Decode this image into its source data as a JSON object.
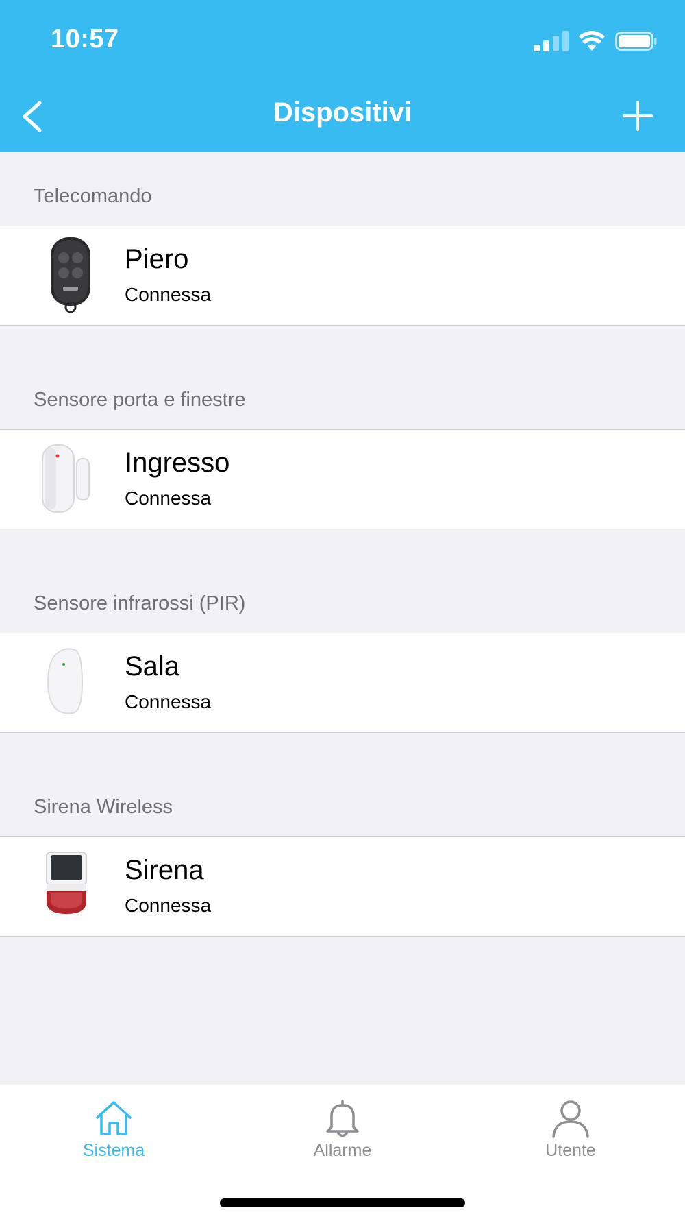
{
  "status_bar": {
    "time": "10:57"
  },
  "nav": {
    "title": "Dispositivi"
  },
  "colors": {
    "accent": "#37bbf0",
    "tab_inactive": "#8e8e93",
    "background": "#f1f1f6"
  },
  "sections": [
    {
      "header": "Telecomando",
      "device": {
        "name": "Piero",
        "status": "Connessa",
        "icon": "remote-keyfob-icon"
      }
    },
    {
      "header": "Sensore porta e finestre",
      "device": {
        "name": "Ingresso",
        "status": "Connessa",
        "icon": "door-sensor-icon"
      }
    },
    {
      "header": "Sensore infrarossi (PIR)",
      "device": {
        "name": "Sala",
        "status": "Connessa",
        "icon": "pir-sensor-icon"
      }
    },
    {
      "header": "Sirena Wireless",
      "device": {
        "name": "Sirena",
        "status": "Connessa",
        "icon": "siren-icon"
      }
    }
  ],
  "tabbar": {
    "tabs": [
      {
        "label": "Sistema",
        "icon": "home-icon",
        "active": true
      },
      {
        "label": "Allarme",
        "icon": "bell-icon",
        "active": false
      },
      {
        "label": "Utente",
        "icon": "user-icon",
        "active": false
      }
    ]
  }
}
